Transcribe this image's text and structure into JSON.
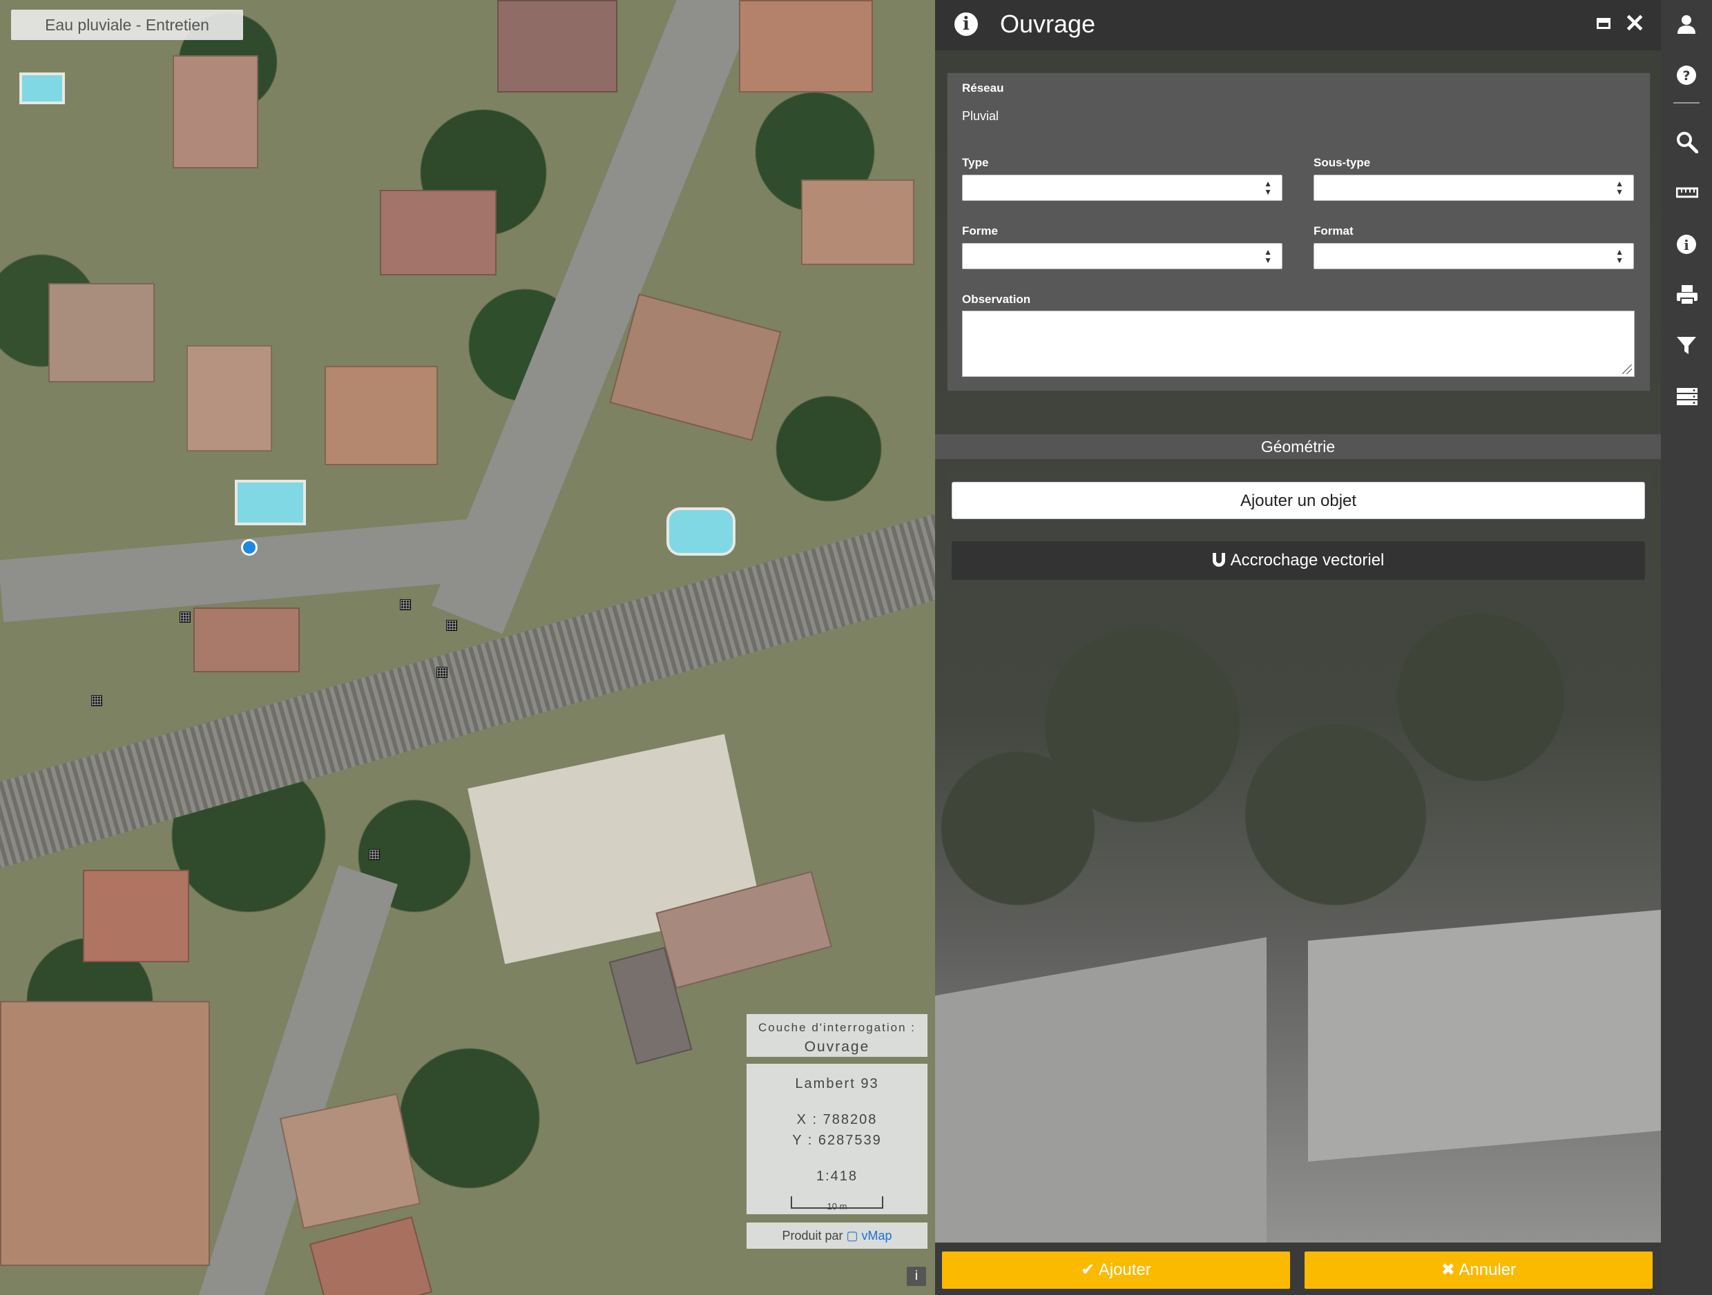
{
  "map": {
    "title": "Eau pluviale - Entretien",
    "query_layer_label": "Couche d'interrogation :",
    "query_layer_value": "Ouvrage",
    "projection": "Lambert 93",
    "x": "X : 788208",
    "y": "Y : 6287539",
    "scale": "1:418",
    "scalebar": "10 m",
    "credits_prefix": "Produit par",
    "credits_brand": "vMap",
    "info_button": "i"
  },
  "dialog": {
    "title": "Ouvrage",
    "form": {
      "reseau_label": "Réseau",
      "reseau_value": "Pluvial",
      "type_label": "Type",
      "type_value": "",
      "soustype_label": "Sous-type",
      "soustype_value": "",
      "forme_label": "Forme",
      "forme_value": "",
      "format_label": "Format",
      "format_value": "",
      "observation_label": "Observation",
      "observation_value": ""
    },
    "geometry": {
      "section_label": "Géométrie",
      "add_object_label": "Ajouter un objet",
      "snap_label": "Accrochage vectoriel"
    },
    "footer": {
      "submit_label": "✔ Ajouter",
      "cancel_label": "✖ Annuler"
    }
  },
  "colors": {
    "accent": "#fbba00",
    "header": "#333333",
    "toolbar": "#3c3c3c",
    "map_point": "#1e88e5"
  },
  "toolbar": {
    "icons": [
      "user-icon",
      "help-icon",
      "search-icon",
      "ruler-icon",
      "info-icon",
      "print-icon",
      "filter-icon",
      "layers-icon"
    ]
  }
}
